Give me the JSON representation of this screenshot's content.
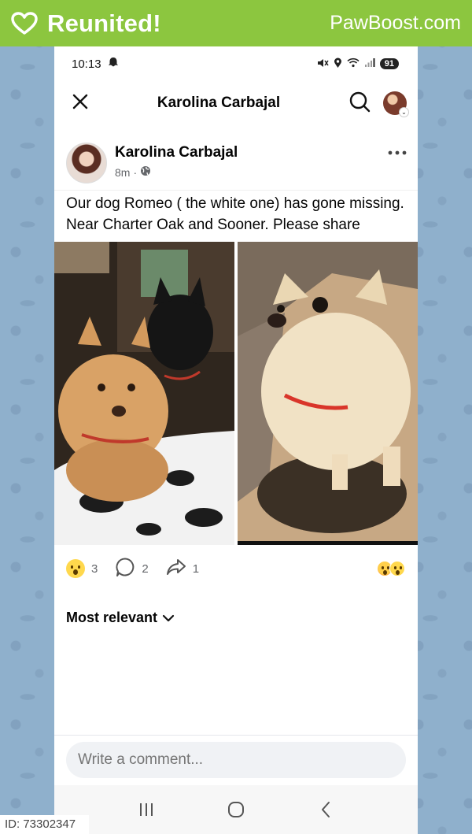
{
  "banner": {
    "title": "Reunited!",
    "brand": "PawBoost.com",
    "background_color": "#8cc63f"
  },
  "status_bar": {
    "time": "10:13",
    "battery": "91"
  },
  "app_bar": {
    "title": "Karolina Carbajal"
  },
  "post": {
    "author": "Karolina Carbajal",
    "time_ago": "8m",
    "separator": "·",
    "text": "Our dog Romeo ( the white one) has gone missing. Near Charter Oak and Sooner. Please share"
  },
  "reactions": {
    "reaction_count": "3",
    "comment_count": "2",
    "share_count": "1"
  },
  "comments": {
    "sort_label": "Most relevant",
    "input_placeholder": "Write a comment..."
  },
  "overlay": {
    "id_label": "ID: 73302347"
  },
  "icons": {
    "banner": "heart-icon",
    "status": [
      "ghost-icon",
      "mute-icon",
      "location-icon",
      "wifi-icon",
      "signal-icon",
      "battery-icon"
    ],
    "app_bar": [
      "close-icon",
      "search-icon",
      "profile-avatar"
    ],
    "post": [
      "globe-icon",
      "more-icon"
    ],
    "actions": [
      "wow-emoji-icon",
      "comment-icon",
      "share-icon"
    ],
    "nav": [
      "recent-apps-icon",
      "home-icon",
      "back-icon"
    ]
  }
}
